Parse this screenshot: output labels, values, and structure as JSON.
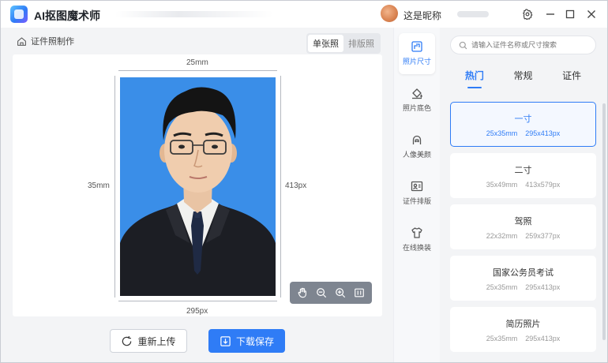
{
  "app": {
    "title": "AI抠图魔术师"
  },
  "user": {
    "nickname": "这是昵称"
  },
  "breadcrumb": {
    "label": "证件照制作"
  },
  "mode_tabs": [
    {
      "label": "单张照",
      "active": true
    },
    {
      "label": "排版照",
      "active": false
    }
  ],
  "canvas": {
    "width_mm": "25mm",
    "height_mm": "35mm",
    "height_px": "413px",
    "width_px": "295px",
    "background_color": "#3a8ee8"
  },
  "actions": {
    "reupload_label": "重新上传",
    "download_label": "下载保存"
  },
  "tools": [
    {
      "label": "照片尺寸",
      "icon": "photo-size-icon",
      "active": true
    },
    {
      "label": "照片底色",
      "icon": "paint-bucket-icon",
      "active": false
    },
    {
      "label": "人像美颜",
      "icon": "face-beauty-icon",
      "active": false
    },
    {
      "label": "证件排版",
      "icon": "id-layout-icon",
      "active": false
    },
    {
      "label": "在线换装",
      "icon": "clothes-icon",
      "active": false
    }
  ],
  "search": {
    "placeholder": "请输入证件名称或尺寸搜索"
  },
  "category_tabs": [
    {
      "label": "热门",
      "active": true
    },
    {
      "label": "常规",
      "active": false
    },
    {
      "label": "证件",
      "active": false
    }
  ],
  "sizes": [
    {
      "name": "一寸",
      "mm": "25x35mm",
      "px": "295x413px",
      "active": true
    },
    {
      "name": "二寸",
      "mm": "35x49mm",
      "px": "413x579px",
      "active": false
    },
    {
      "name": "驾照",
      "mm": "22x32mm",
      "px": "259x377px",
      "active": false
    },
    {
      "name": "国家公务员考试",
      "mm": "25x35mm",
      "px": "295x413px",
      "active": false
    },
    {
      "name": "简历照片",
      "mm": "25x35mm",
      "px": "295x413px",
      "active": false
    }
  ],
  "colors": {
    "accent": "#2f7cf6"
  }
}
